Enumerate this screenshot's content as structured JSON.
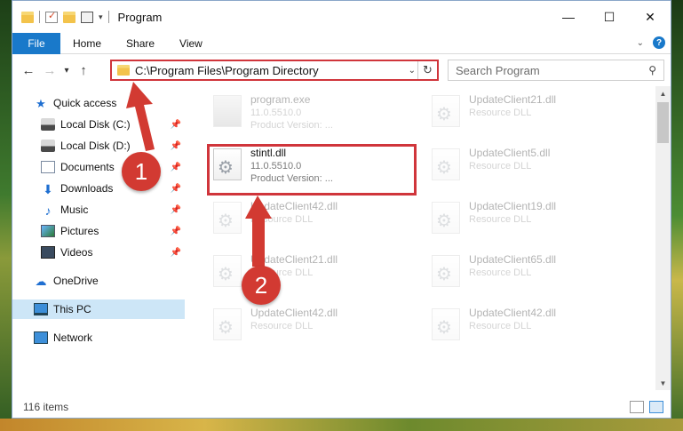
{
  "window": {
    "title": "Program",
    "controls": {
      "minimize": "—",
      "maximize": "☐",
      "close": "✕"
    }
  },
  "ribbon": {
    "file_tab": "File",
    "tabs": [
      "Home",
      "Share",
      "View"
    ]
  },
  "navigation": {
    "back": "←",
    "forward": "→",
    "up": "↑",
    "address_path": "C:\\Program Files\\Program Directory",
    "refresh": "↻",
    "search_placeholder": "Search Program"
  },
  "sidebar": {
    "items": [
      {
        "label": "Quick access",
        "icon": "star-icon",
        "pinned": false
      },
      {
        "label": "Local Disk (C:)",
        "icon": "disk-icon",
        "pinned": true
      },
      {
        "label": "Local Disk (D:)",
        "icon": "disk-icon",
        "pinned": true
      },
      {
        "label": "Documents",
        "icon": "documents-icon",
        "pinned": true
      },
      {
        "label": "Downloads",
        "icon": "download-icon",
        "pinned": true
      },
      {
        "label": "Music",
        "icon": "music-icon",
        "pinned": true
      },
      {
        "label": "Pictures",
        "icon": "pictures-icon",
        "pinned": true
      },
      {
        "label": "Videos",
        "icon": "videos-icon",
        "pinned": true
      },
      {
        "label": "OneDrive",
        "icon": "cloud-icon",
        "pinned": false
      },
      {
        "label": "This PC",
        "icon": "computer-icon",
        "pinned": false,
        "selected": true
      },
      {
        "label": "Network",
        "icon": "network-icon",
        "pinned": false
      }
    ],
    "pin_glyph": "📌"
  },
  "files": [
    {
      "name": "program.exe",
      "line2": "11.0.5510.0",
      "line3": "Product Version:   ...",
      "icon": "exe-icon"
    },
    {
      "name": "UpdateClient21.dll",
      "line2": "Resource DLL",
      "line3": "",
      "icon": "dll-icon"
    },
    {
      "name": "stintl.dll",
      "line2": "11.0.5510.0",
      "line3": "Product Version:   ...",
      "icon": "dll-icon",
      "highlighted": true
    },
    {
      "name": "UpdateClient5.dll",
      "line2": "Resource DLL",
      "line3": "",
      "icon": "dll-icon"
    },
    {
      "name": "UpdateClient42.dll",
      "line2": "Resource DLL",
      "line3": "",
      "icon": "dll-icon"
    },
    {
      "name": "UpdateClient19.dll",
      "line2": "Resource DLL",
      "line3": "",
      "icon": "dll-icon"
    },
    {
      "name": "UpdateClient21.dll",
      "line2": "Resource DLL",
      "line3": "",
      "icon": "dll-icon"
    },
    {
      "name": "UpdateClient65.dll",
      "line2": "Resource DLL",
      "line3": "",
      "icon": "dll-icon"
    },
    {
      "name": "UpdateClient42.dll",
      "line2": "Resource DLL",
      "line3": "",
      "icon": "dll-icon"
    },
    {
      "name": "UpdateClient42.dll",
      "line2": "Resource DLL",
      "line3": "",
      "icon": "dll-icon"
    }
  ],
  "status": {
    "item_count": "116 items"
  },
  "annotations": {
    "step1": "1",
    "step2": "2",
    "color": "#d0353b"
  }
}
